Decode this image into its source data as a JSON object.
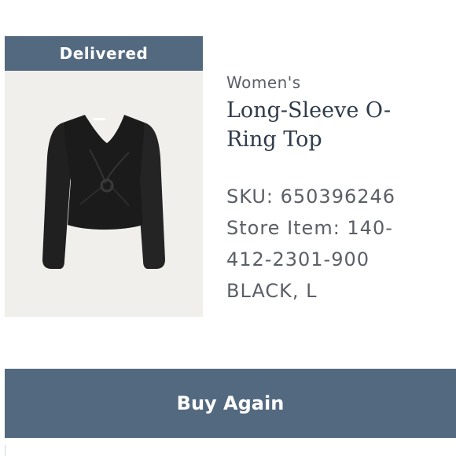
{
  "colors": {
    "accent": "#52697f"
  },
  "order_item": {
    "status": "Delivered",
    "category": "Women's",
    "title": "Long-Sleeve O-Ring Top",
    "sku": "SKU: 650396246",
    "store_item": "Store Item: 140-412-2301-900",
    "variant": "BLACK, L",
    "image_icon": "black-long-sleeve-o-ring-top-image"
  },
  "actions": {
    "buy_again_label": "Buy Again"
  }
}
